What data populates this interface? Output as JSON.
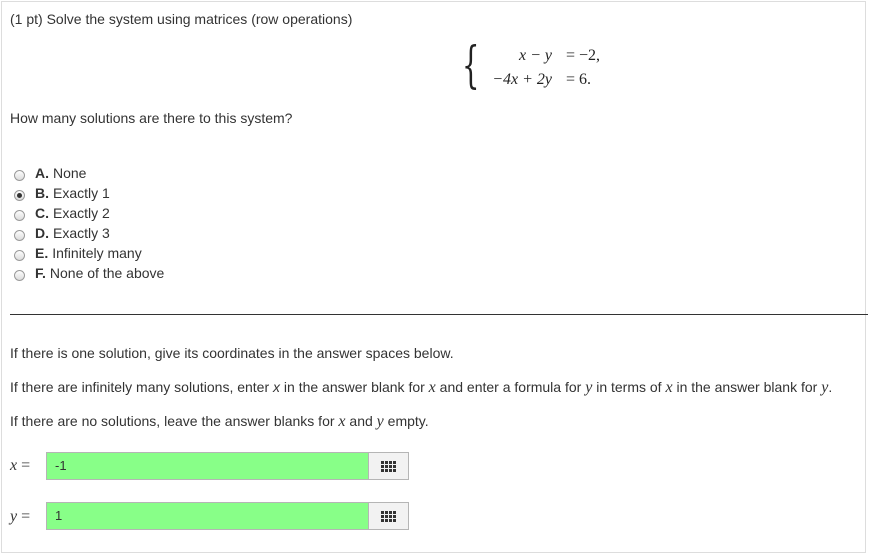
{
  "question": {
    "title": "(1 pt) Solve the system using matrices (row operations)",
    "system": {
      "row1_lhs": "x − y",
      "row1_rhs": "= −2,",
      "row2_lhs": "−4x + 2y",
      "row2_rhs": "= 6."
    },
    "prompt": "How many solutions are there to this system?",
    "options": [
      {
        "letter": "A.",
        "text": "None",
        "selected": false
      },
      {
        "letter": "B.",
        "text": "Exactly 1",
        "selected": true
      },
      {
        "letter": "C.",
        "text": "Exactly 2",
        "selected": false
      },
      {
        "letter": "D.",
        "text": "Exactly 3",
        "selected": false
      },
      {
        "letter": "E.",
        "text": "Infinitely many",
        "selected": false
      },
      {
        "letter": "F.",
        "text": "None of the above",
        "selected": false
      }
    ]
  },
  "instructions": {
    "one_solution": "If there is one solution, give its coordinates in the answer spaces below.",
    "inf_part1": "If there are infinitely many solutions, enter ",
    "inf_x_plain": "x",
    "inf_part2": " in the answer blank for ",
    "inf_x_math": "x",
    "inf_part3": " and enter a formula for ",
    "inf_y_math": "y",
    "inf_part4": " in terms of ",
    "inf_x_math2": "x",
    "inf_part5": " in the answer blank for ",
    "inf_y_math2": "y",
    "inf_part6": ".",
    "none_part1": "If there are no solutions, leave the answer blanks for ",
    "none_x": "x",
    "none_part2": " and ",
    "none_y": "y",
    "none_part3": " empty."
  },
  "answers": {
    "x_var": "x",
    "y_var": "y",
    "equals": " =",
    "x_value": "-1",
    "y_value": "1",
    "x_status_color": "#88ff88",
    "y_status_color": "#88ff88",
    "palette_icon": "grid-icon"
  }
}
